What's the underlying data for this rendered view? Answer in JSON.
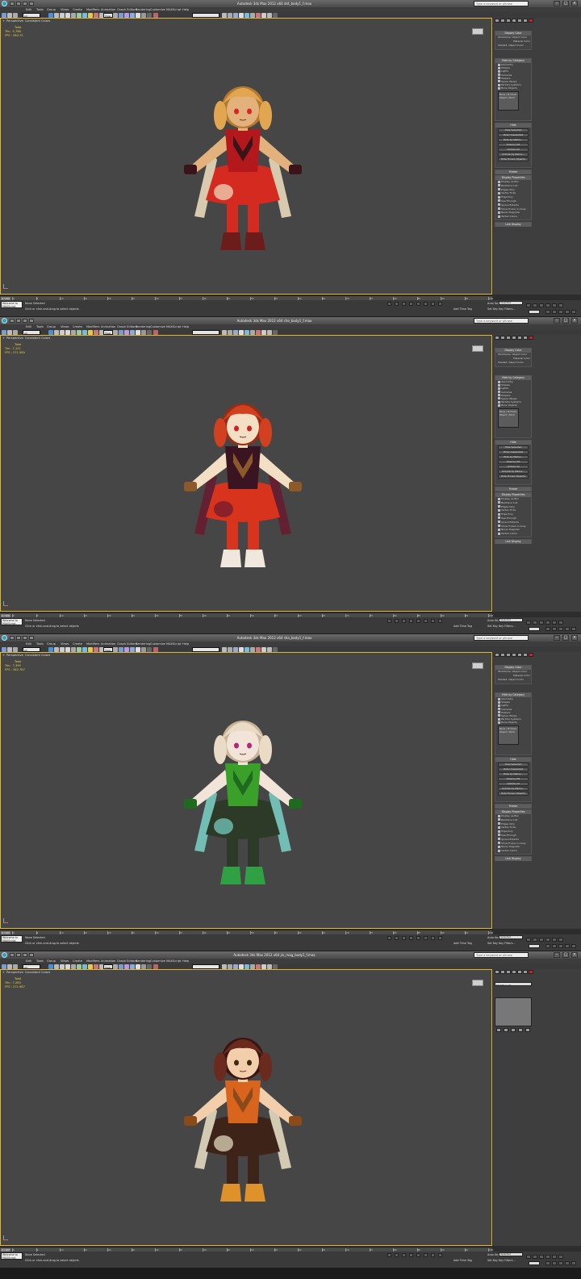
{
  "menu": [
    "Edit",
    "Tools",
    "Group",
    "Views",
    "Create",
    "Modifiers",
    "Animation",
    "Graph Editors",
    "Rendering",
    "Customize",
    "MAXScript",
    "Help"
  ],
  "toolbar": {
    "selection_filter": "All",
    "view_dropdown": "View"
  },
  "viewport_labels": [
    "+",
    "Perspective",
    "Consistent Colors"
  ],
  "stats_labels": {
    "header": "Total",
    "tris": "Tris",
    "fps": "FPS"
  },
  "search_placeholder": "Type a keyword or phrase",
  "status": {
    "selected": "None Selected",
    "hint": "Click or click-and-drag to select objects",
    "welcome": "Welcome to MAXScript.",
    "add_time_tag": "Add Time Tag",
    "auto_key": "Auto Key",
    "set_key": "Set Key",
    "key_filter": "Selected",
    "key_filters": "Key Filters..."
  },
  "timeline_ticks": [
    "0",
    "5",
    "10",
    "15",
    "20",
    "25",
    "30",
    "35",
    "40",
    "45",
    "50",
    "55",
    "60",
    "65",
    "70",
    "75",
    "80",
    "85",
    "90",
    "95",
    "100"
  ],
  "display_panel": {
    "display_color": "Display Color",
    "wireframe": "Wireframe:",
    "shaded": "Shaded:",
    "object_color": "Object Color",
    "material_color": "Material Color",
    "hide_by_category": "Hide by Category",
    "categories": [
      "Geometry",
      "Shapes",
      "Lights",
      "Cameras",
      "Helpers",
      "Space Warps",
      "Particle Systems",
      "Bone Objects"
    ],
    "cat_buttons": [
      "All",
      "None",
      "Invert"
    ],
    "list_label": "Bone / IK Chain Object / Point",
    "add": "Add...",
    "remove": "Remove",
    "none": "None",
    "hide": "Hide",
    "hide_buttons": [
      "Hide Selected",
      "Hide Unselected",
      "Hide by Name...",
      "Hide by Hit",
      "Unhide All",
      "Unhide by Name...",
      "Hide Frozen Objects"
    ],
    "freeze": "Freeze",
    "display_properties": "Display Properties",
    "props": [
      "Display as Box",
      "Backface Cull",
      "Edges Only",
      "Vertex Ticks",
      "Trajectory",
      "See-Through",
      "Ignore Extents",
      "Show Frozen in Gray",
      "Never Degrade",
      "Vertex Colors"
    ],
    "shaded_btn": "Shaded",
    "link_display": "Link Display"
  },
  "modify_panel": {
    "modifier_list": "Modifier List"
  },
  "windows": [
    {
      "title": "Autodesk 3ds Max  2012 x64     dnt_body1_f.max",
      "frame": "0 / 100",
      "tris": "5,788",
      "fps": "284.75",
      "time": "0:0:0",
      "mode": "display",
      "skin": "#e3b27c",
      "hair": "#e3a650",
      "hair_dark": "#b7792d",
      "top": "#b3181c",
      "top_dark": "#3a1418",
      "pants": "#d42a20",
      "pants_light": "#f2e2c2",
      "boots": "#6c1c1a",
      "eyes": "#d22"
    },
    {
      "title": "Autodesk 3ds Max  2012 x64     che_body1_f.max",
      "frame": "0 / 100",
      "tris": "7,121",
      "fps": "271.580",
      "time": "0:0:0",
      "mode": "display",
      "skin": "#f2dfc4",
      "hair": "#d2411f",
      "hair_dark": "#9c2b12",
      "top": "#3a1420",
      "top_dark": "#8c5a2a",
      "pants": "#d8331c",
      "pants_light": "#6a1a30",
      "boots": "#f0e8dc",
      "eyes": "#c22"
    },
    {
      "title": "Autodesk 3ds Max  2012 x64     sha_body1_f.max",
      "frame": "0 / 100",
      "tris": "7,399",
      "fps": "282.787",
      "time": "0:0:0",
      "mode": "display",
      "skin": "#f2e4d8",
      "hair": "#eadbc6",
      "hair_dark": "#c9b498",
      "top": "#3aa02a",
      "top_dark": "#1e6a1e",
      "pants": "#2e3a28",
      "pants_light": "#7ad2c8",
      "boots": "#2fa043",
      "eyes": "#b3267a"
    },
    {
      "title": "Autodesk 3ds Max  2012 x64     jin_mag_body1_f.max",
      "frame": "0 / 100",
      "tris": "7,283",
      "fps": "271.987",
      "time": "0:0:0",
      "mode": "modify",
      "skin": "#f2ceaa",
      "hair": "#6a2a1e",
      "hair_dark": "#3c1410",
      "top": "#d8641e",
      "top_dark": "#8a4a1a",
      "pants": "#3e2418",
      "pants_light": "#ece2c8",
      "boots": "#e0922a",
      "eyes": "#3a2a10"
    }
  ]
}
